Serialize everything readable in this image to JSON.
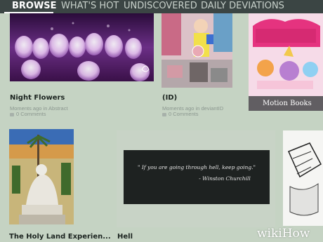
{
  "nav": {
    "tabs": [
      {
        "label": "BROWSE",
        "active": true
      },
      {
        "label": "WHAT'S HOT",
        "active": false
      },
      {
        "label": "UNDISCOVERED",
        "active": false
      },
      {
        "label": "DAILY DEVIATIONS",
        "active": false
      }
    ]
  },
  "cards": [
    {
      "title": "Night Flowers",
      "meta": "Moments ago in Abstract",
      "comments": "0 Comments"
    },
    {
      "title": "(ID)",
      "meta": "Moments ago in deviantID",
      "comments": "0 Comments"
    },
    {
      "caption": "Motion Books"
    },
    {
      "title": "The Holy Land Experien..."
    },
    {
      "title": "Hell",
      "quote_line1": "\" If you are going through hell, keep going.\"",
      "quote_line2": "- Winston Churchill"
    }
  ],
  "watermark": "wikiHow",
  "colors": {
    "background": "#c5d3c3",
    "nav": "#3b4544",
    "title_text": "#1b231f",
    "meta_text": "#8b978f"
  }
}
